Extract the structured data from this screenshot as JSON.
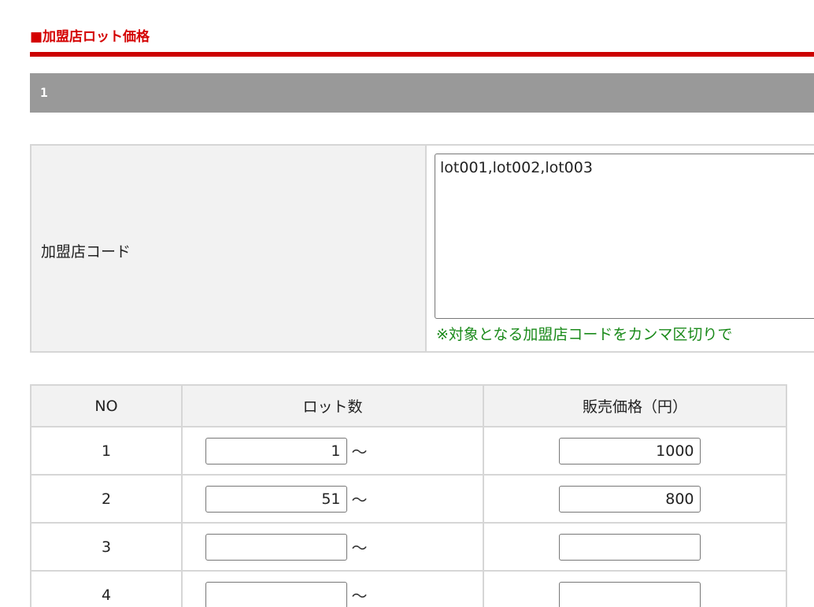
{
  "section": {
    "title": "■加盟店ロット価格"
  },
  "group": {
    "number": "1"
  },
  "merchant_code": {
    "label": "加盟店コード",
    "value": "lot001,lot002,lot003",
    "hint": "※対象となる加盟店コードをカンマ区切りで"
  },
  "lot_table": {
    "headers": {
      "no": "NO",
      "lot": "ロット数",
      "price": "販売価格（円）"
    },
    "tilde": "〜",
    "rows": [
      {
        "no": "1",
        "lot": "1",
        "price": "1000"
      },
      {
        "no": "2",
        "lot": "51",
        "price": "800"
      },
      {
        "no": "3",
        "lot": "",
        "price": ""
      },
      {
        "no": "4",
        "lot": "",
        "price": ""
      }
    ]
  }
}
